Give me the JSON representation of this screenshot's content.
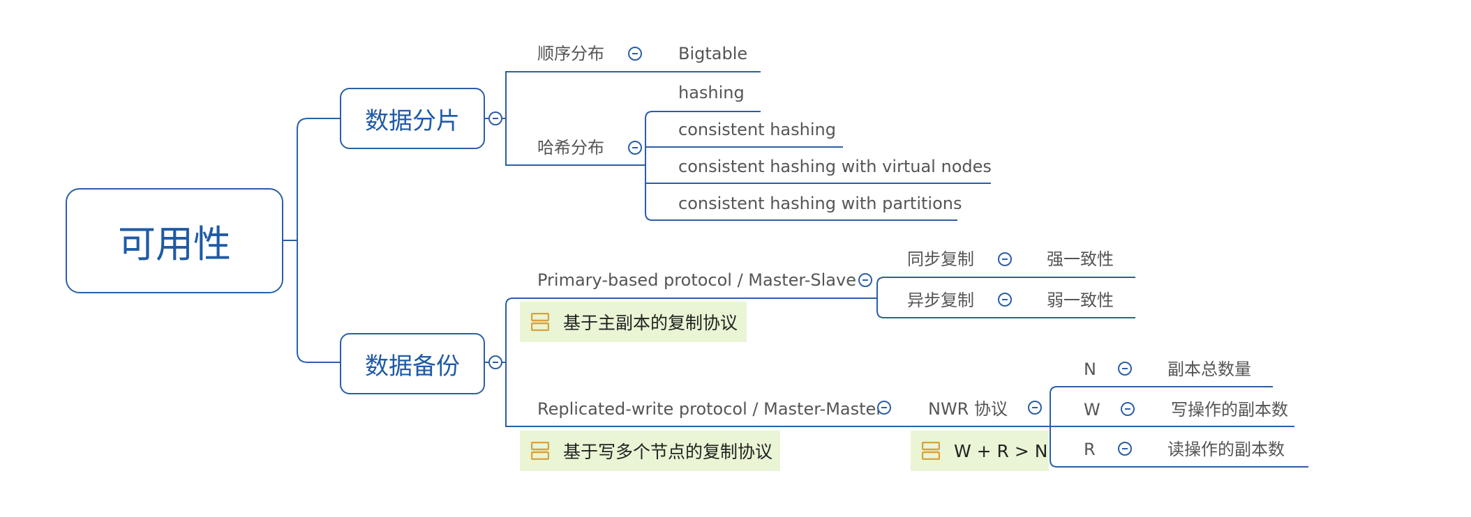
{
  "root": {
    "label": "可用性"
  },
  "sharding": {
    "label": "数据分片",
    "sequential": {
      "label": "顺序分布",
      "child": "Bigtable"
    },
    "hash": {
      "label": "哈希分布",
      "children": [
        "hashing",
        "consistent hashing",
        "consistent hashing  with virtual nodes",
        "consistent hashing with partitions"
      ]
    }
  },
  "replication": {
    "label": "数据备份",
    "primary": {
      "label": "Primary-based protocol / Master-Slave",
      "note": "基于主副本的复制协议",
      "sync": {
        "label": "同步复制",
        "child": "强一致性"
      },
      "async": {
        "label": "异步复制",
        "child": "弱一致性"
      }
    },
    "replicated_write": {
      "label": "Replicated-write protocol / Master-Master",
      "note": "基于写多个节点的复制协议",
      "nwr": {
        "label": "NWR 协议",
        "note": "W + R > N",
        "items": [
          {
            "key": "N",
            "desc": "副本总数量"
          },
          {
            "key": "W",
            "desc": "写操作的副本数"
          },
          {
            "key": "R",
            "desc": "读操作的副本数"
          }
        ]
      }
    }
  },
  "colors": {
    "line": "#2a5ea6",
    "node_text": "#1f5aa6",
    "label_text": "#555555",
    "note_bg": "#e9f5d4",
    "note_icon": "#d9a13b"
  },
  "icons": {
    "collapse": "minus-circle-icon",
    "note": "note-icon"
  }
}
